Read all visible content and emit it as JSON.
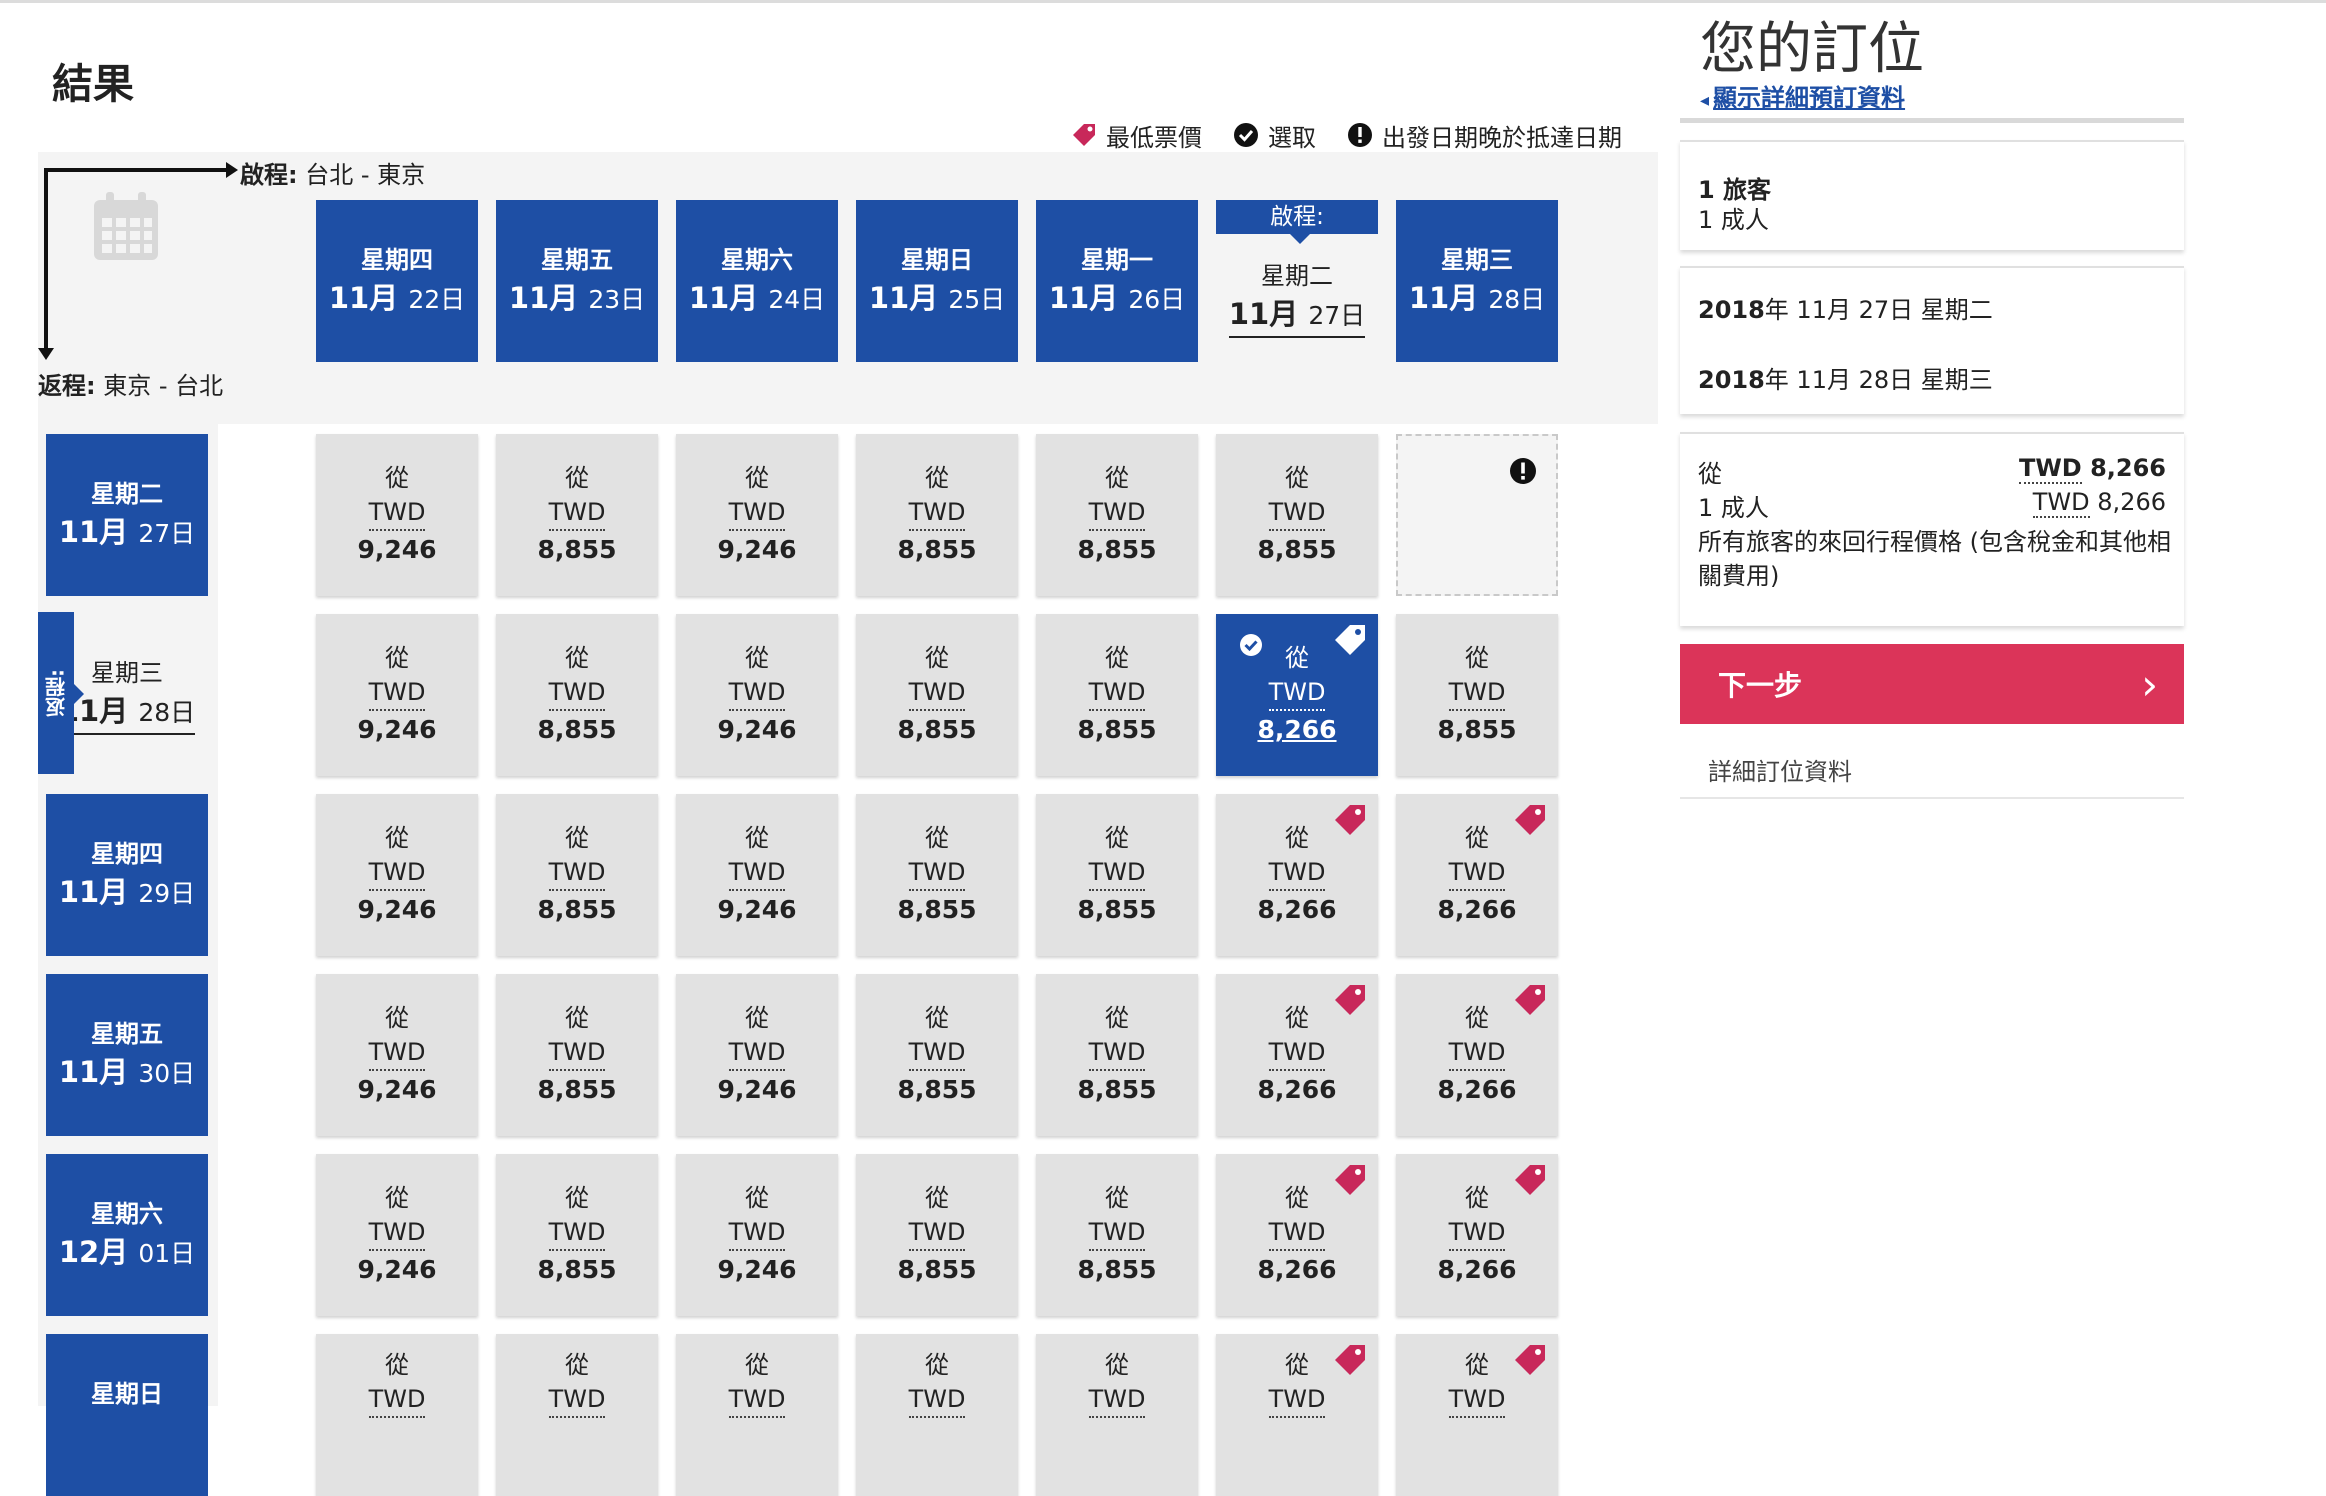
{
  "left": {
    "title": "結果",
    "outbound_prefix": "啟程:",
    "outbound_route": "台北 - 東京",
    "return_prefix": "返程:",
    "return_route": "東京 - 台北",
    "return_tab": "返程:",
    "selected_tag": "啟程:"
  },
  "legend": {
    "lowest": "最低票價",
    "selected": "選取",
    "warning": "出發日期晚於抵達日期"
  },
  "dep_headers": [
    {
      "wd": "星期四",
      "m": "11月",
      "d": "22日"
    },
    {
      "wd": "星期五",
      "m": "11月",
      "d": "23日"
    },
    {
      "wd": "星期六",
      "m": "11月",
      "d": "24日"
    },
    {
      "wd": "星期日",
      "m": "11月",
      "d": "25日"
    },
    {
      "wd": "星期一",
      "m": "11月",
      "d": "26日"
    },
    {
      "wd": "星期二",
      "m": "11月",
      "d": "27日"
    },
    {
      "wd": "星期三",
      "m": "11月",
      "d": "28日"
    }
  ],
  "ret_headers": [
    {
      "wd": "星期二",
      "m": "11月",
      "d": "27日"
    },
    {
      "wd": "星期三",
      "m": "11月",
      "d": "28日"
    },
    {
      "wd": "星期四",
      "m": "11月",
      "d": "29日"
    },
    {
      "wd": "星期五",
      "m": "11月",
      "d": "30日"
    },
    {
      "wd": "星期六",
      "m": "12月",
      "d": "01日"
    },
    {
      "wd": "星期日",
      "m": "",
      "d": ""
    }
  ],
  "cell_text": {
    "from": "從",
    "currency": "TWD"
  },
  "grid": [
    [
      "9,246",
      "8,855",
      "9,246",
      "8,855",
      "8,855",
      "8,855",
      ""
    ],
    [
      "9,246",
      "8,855",
      "9,246",
      "8,855",
      "8,855",
      "8,266",
      "8,855"
    ],
    [
      "9,246",
      "8,855",
      "9,246",
      "8,855",
      "8,855",
      "8,266",
      "8,266"
    ],
    [
      "9,246",
      "8,855",
      "9,246",
      "8,855",
      "8,855",
      "8,266",
      "8,266"
    ],
    [
      "9,246",
      "8,855",
      "9,246",
      "8,855",
      "8,855",
      "8,266",
      "8,266"
    ],
    [
      "",
      "",
      "",
      "",
      "",
      "",
      ""
    ]
  ],
  "right": {
    "title": "您的訂位",
    "details_link": "顯示詳細預訂資料",
    "travelers_bold": "1 旅客",
    "travelers_sub": "1 成人",
    "outbound_date_y": "2018",
    "outbound_date_rest": "年 11月 27日 星期二",
    "return_date_y": "2018",
    "return_date_rest": "年 11月 28日 星期三",
    "price_from": "從",
    "price_currency": "TWD",
    "price_total": "8,266",
    "adult_label": "1 成人",
    "adult_currency": "TWD",
    "adult_price": "8,266",
    "note_line1": "所有旅客的來回行程價格 (包含稅金和其他相",
    "note_line2": "關費用)",
    "next_button": "下一步",
    "booking_details": "詳細訂位資料"
  },
  "colors": {
    "accent": "#1e4fa5",
    "cta": "#db3459",
    "tag": "#c8285a"
  }
}
